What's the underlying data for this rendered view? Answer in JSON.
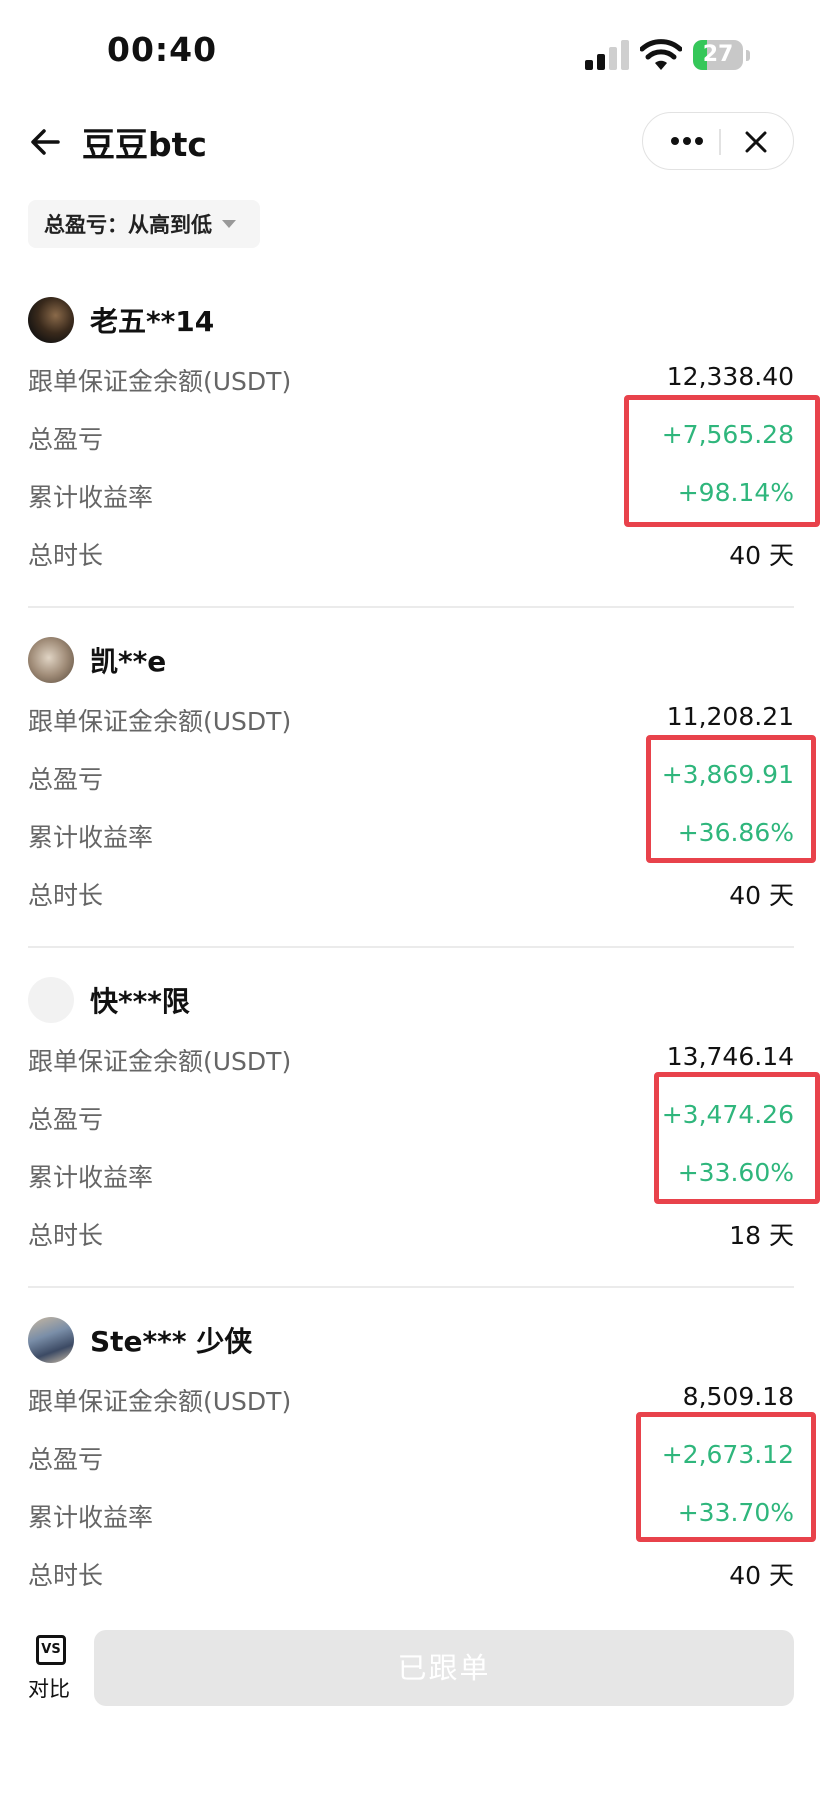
{
  "status_bar": {
    "time": "00:40",
    "battery": "27"
  },
  "header": {
    "title": "豆豆btc"
  },
  "sort": {
    "label": "总盈亏：从高到低"
  },
  "colors": {
    "positive": "#2fb67c",
    "highlight_border": "#e8424b"
  },
  "traders": [
    {
      "name": "老五**14",
      "margin_label": "跟单保证金余额(USDT)",
      "margin": "12,338.40",
      "pnl_label": "总盈亏",
      "pnl": "+7,565.28",
      "roi_label": "累计收益率",
      "roi": "+98.14%",
      "duration_label": "总时长",
      "duration": "40 天"
    },
    {
      "name": "凯**e",
      "margin_label": "跟单保证金余额(USDT)",
      "margin": "11,208.21",
      "pnl_label": "总盈亏",
      "pnl": "+3,869.91",
      "roi_label": "累计收益率",
      "roi": "+36.86%",
      "duration_label": "总时长",
      "duration": "40 天"
    },
    {
      "name": "快***限",
      "margin_label": "跟单保证金余额(USDT)",
      "margin": "13,746.14",
      "pnl_label": "总盈亏",
      "pnl": "+3,474.26",
      "roi_label": "累计收益率",
      "roi": "+33.60%",
      "duration_label": "总时长",
      "duration": "18 天"
    },
    {
      "name": "Ste*** 少侠",
      "margin_label": "跟单保证金余额(USDT)",
      "margin": "8,509.18",
      "pnl_label": "总盈亏",
      "pnl": "+2,673.12",
      "roi_label": "累计收益率",
      "roi": "+33.70%",
      "duration_label": "总时长",
      "duration": "40 天"
    }
  ],
  "footer": {
    "vs_icon": "VS",
    "compare_label": "对比",
    "follow_button": "已跟单"
  }
}
